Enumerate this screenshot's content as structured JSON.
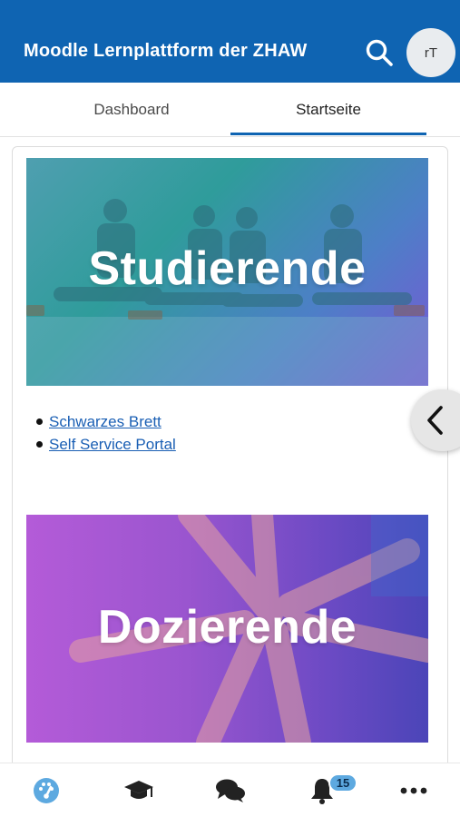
{
  "header": {
    "title": "Moodle Lernplattform der ZHAW",
    "avatar_initials": "rT",
    "color": "#0f64b2"
  },
  "tabs": [
    {
      "label": "Dashboard",
      "active": false
    },
    {
      "label": "Startseite",
      "active": true
    }
  ],
  "main": {
    "banners": [
      {
        "label": "Studierende"
      },
      {
        "label": "Dozierende"
      }
    ],
    "links": [
      {
        "label": "Schwarzes Brett"
      },
      {
        "label": "Self Service Portal"
      }
    ]
  },
  "bottom_nav": {
    "items": [
      {
        "icon": "dashboard-gauge-icon",
        "active": true
      },
      {
        "icon": "graduation-cap-icon",
        "active": false
      },
      {
        "icon": "chat-bubbles-icon",
        "active": false
      },
      {
        "icon": "bell-icon",
        "active": false
      },
      {
        "icon": "more-dots-icon",
        "active": false
      }
    ],
    "notification_count": "15"
  }
}
